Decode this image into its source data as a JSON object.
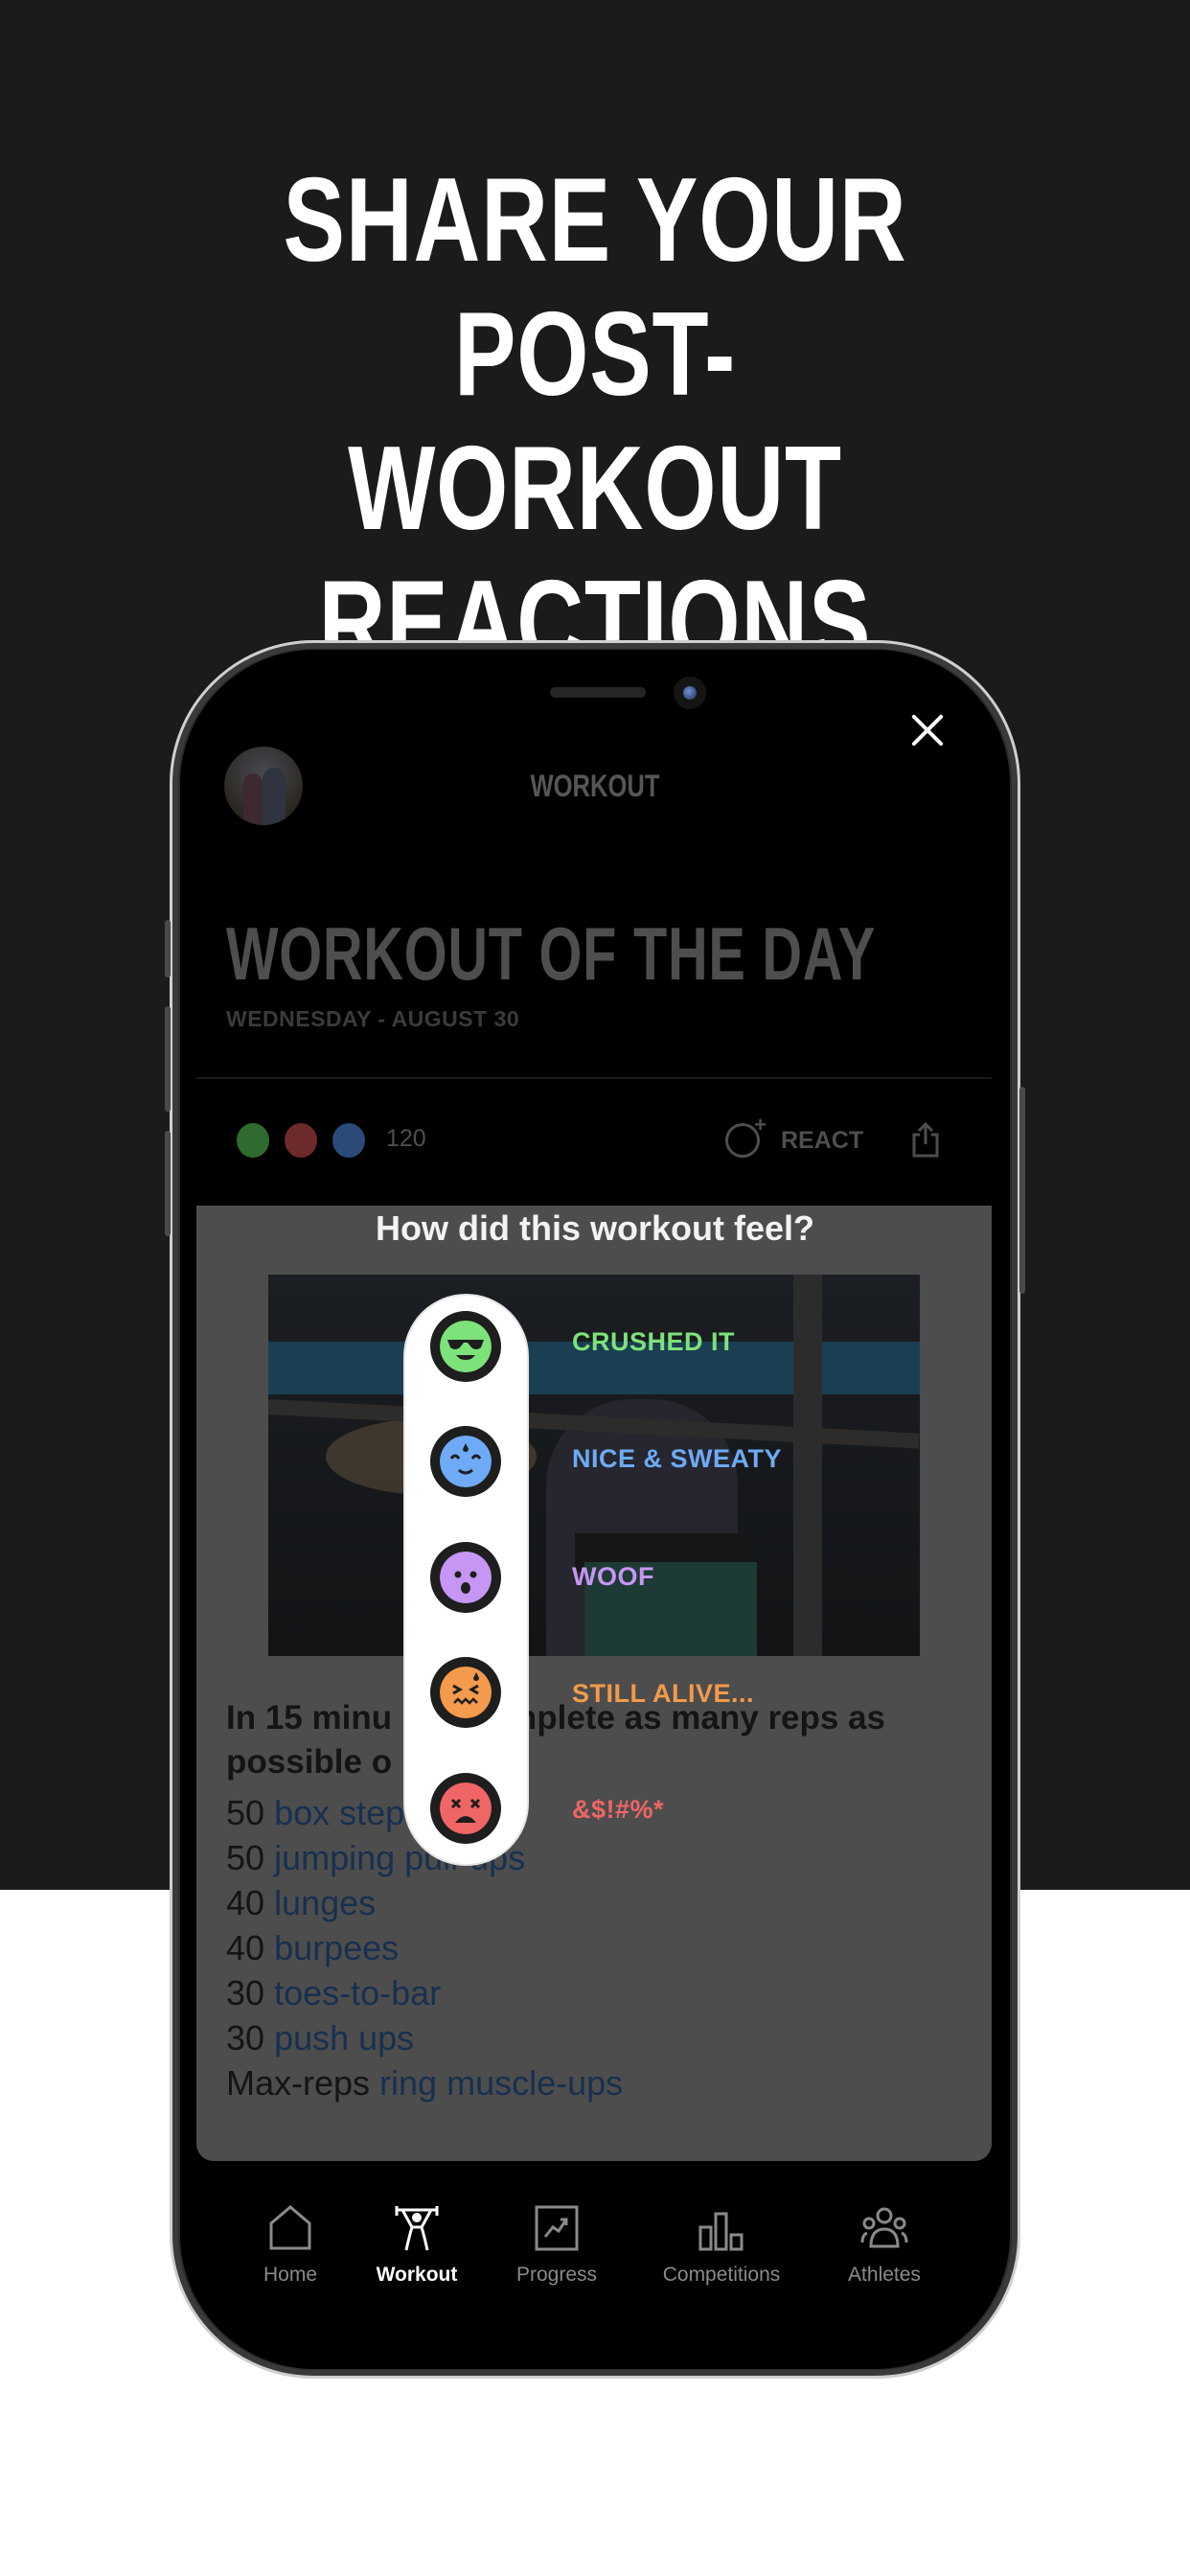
{
  "promo": {
    "headline_line1": "SHARE YOUR POST-",
    "headline_line2": "WORKOUT REACTIONS"
  },
  "header": {
    "title": "WORKOUT",
    "close_icon": "close-icon",
    "avatar": "user-avatar"
  },
  "workout": {
    "title": "WORKOUT OF THE DAY",
    "date": "WEDNESDAY - AUGUST 30",
    "reaction_count": "120",
    "react_label": "REACT",
    "description": "In 15 minutes, complete as many reps as possible of:",
    "description_visible_part1": "In 15 minu",
    "description_visible_part2": "mplete as many reps as",
    "description_visible_part3": "possible o",
    "movements": [
      {
        "reps": "50",
        "name": "box step-ups"
      },
      {
        "reps": "50",
        "name": "jumping pull-ups"
      },
      {
        "reps": "40",
        "name": "lunges"
      },
      {
        "reps": "40",
        "name": "burpees"
      },
      {
        "reps": "30",
        "name": "toes-to-bar"
      },
      {
        "reps": "30",
        "name": "push ups"
      },
      {
        "reps": "Max-reps",
        "name": "ring muscle-ups"
      }
    ]
  },
  "reaction_picker": {
    "question": "How did this workout feel?",
    "options": [
      {
        "label": "CRUSHED IT",
        "icon": "cool-sunglasses-emoji",
        "color": "#7de27a"
      },
      {
        "label": "NICE & SWEATY",
        "icon": "sweaty-smile-emoji",
        "color": "#6eaaf5"
      },
      {
        "label": "WOOF",
        "icon": "shocked-emoji",
        "color": "#c596f4"
      },
      {
        "label": "STILL ALIVE...",
        "icon": "exhausted-emoji",
        "color": "#f39a4c"
      },
      {
        "label": "&$!#%*",
        "icon": "dead-x-eyes-emoji",
        "color": "#f06565"
      }
    ]
  },
  "tabbar": {
    "active": "Workout",
    "tabs": [
      {
        "label": "Home",
        "icon": "home-icon"
      },
      {
        "label": "Workout",
        "icon": "weightlifter-icon"
      },
      {
        "label": "Progress",
        "icon": "chart-trend-icon"
      },
      {
        "label": "Competitions",
        "icon": "podium-bars-icon"
      },
      {
        "label": "Athletes",
        "icon": "people-group-icon"
      }
    ]
  }
}
